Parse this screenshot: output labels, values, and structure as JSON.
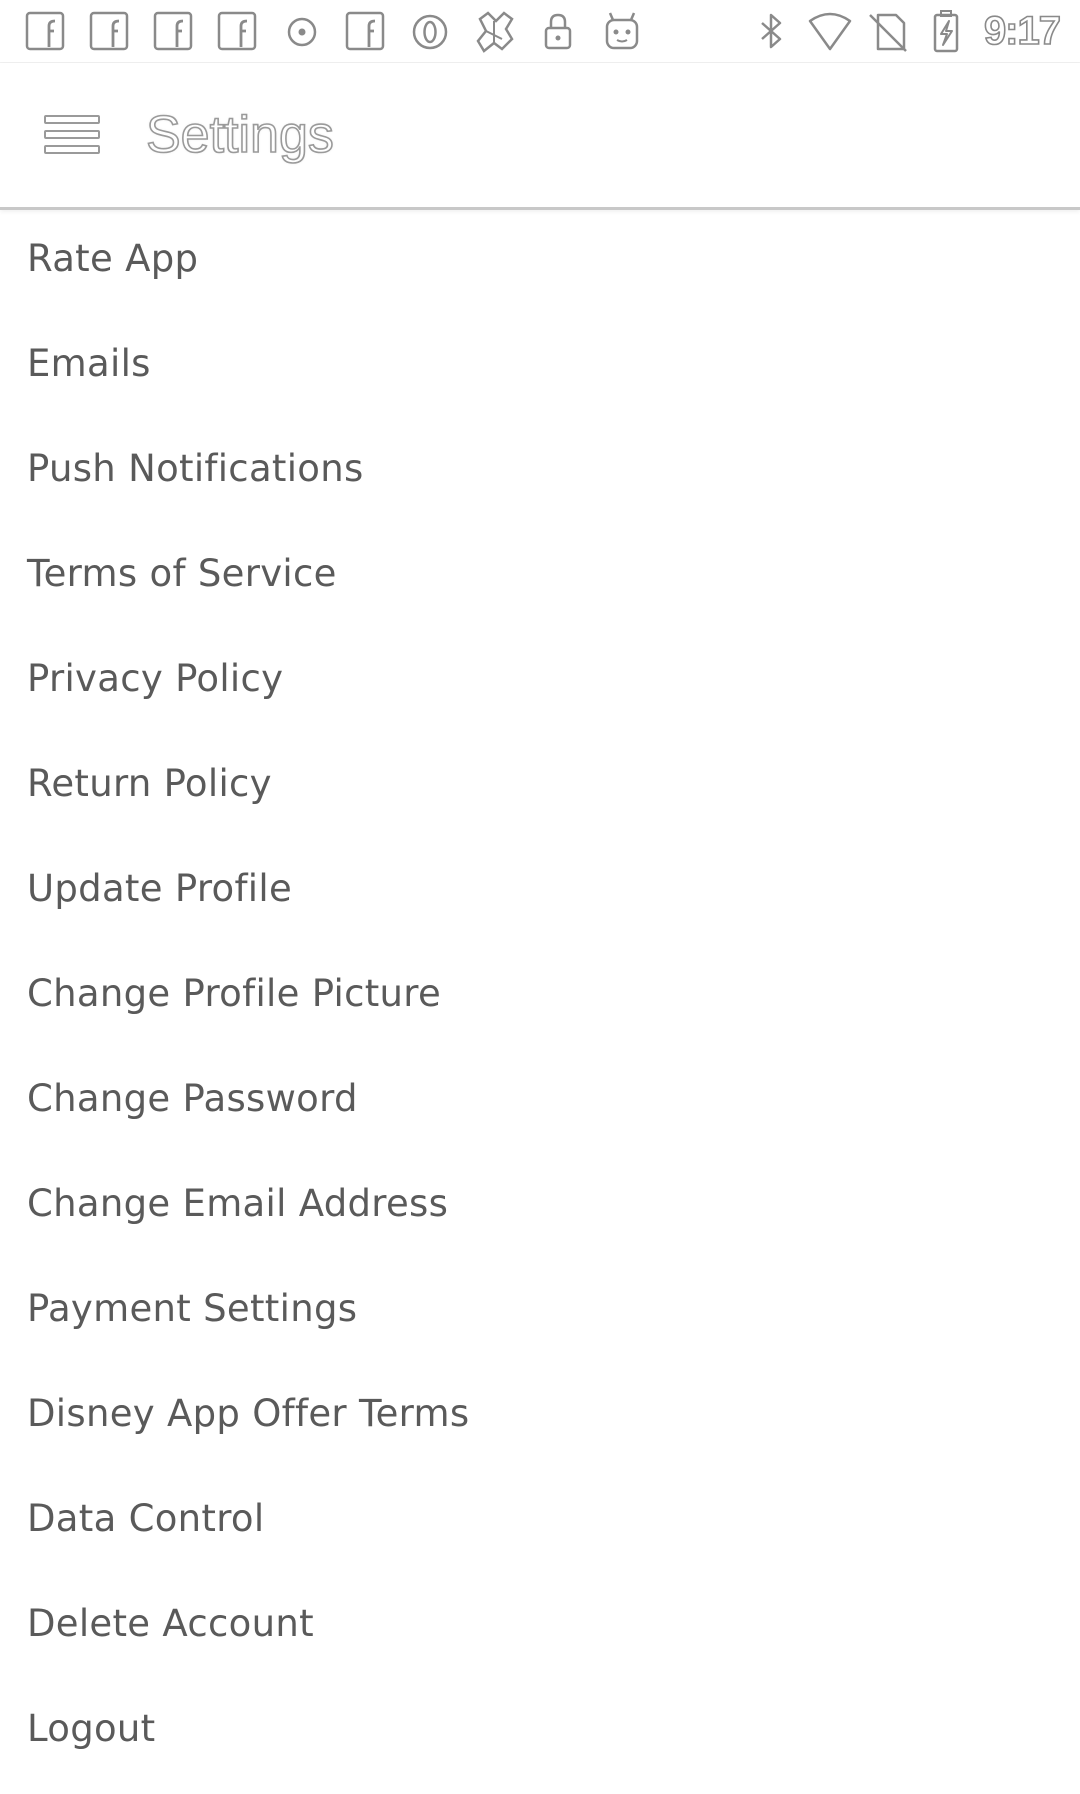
{
  "status_bar": {
    "time": "9:17",
    "notification_icons": [
      "facebook-icon",
      "facebook-icon",
      "facebook-icon",
      "facebook-icon",
      "record-icon",
      "facebook-icon",
      "opera-icon",
      "gift-icon",
      "lock-icon",
      "android-icon"
    ],
    "system_icons": [
      "bluetooth-icon",
      "wifi-icon",
      "no-sim-icon",
      "battery-charging-icon"
    ]
  },
  "app_bar": {
    "title": "Settings",
    "menu_icon": "hamburger-menu-icon"
  },
  "settings": {
    "items": [
      {
        "label": "Rate App"
      },
      {
        "label": "Emails"
      },
      {
        "label": "Push Notifications"
      },
      {
        "label": "Terms of Service"
      },
      {
        "label": "Privacy Policy"
      },
      {
        "label": "Return Policy"
      },
      {
        "label": "Update Profile"
      },
      {
        "label": "Change Profile Picture"
      },
      {
        "label": "Change Password"
      },
      {
        "label": "Change Email Address"
      },
      {
        "label": "Payment Settings"
      },
      {
        "label": "Disney App Offer Terms"
      },
      {
        "label": "Data Control"
      },
      {
        "label": "Delete Account"
      },
      {
        "label": "Logout"
      }
    ]
  },
  "colors": {
    "background": "#ffffff",
    "item_text": "#5a5a5a",
    "divider": "#c8c8c8"
  }
}
